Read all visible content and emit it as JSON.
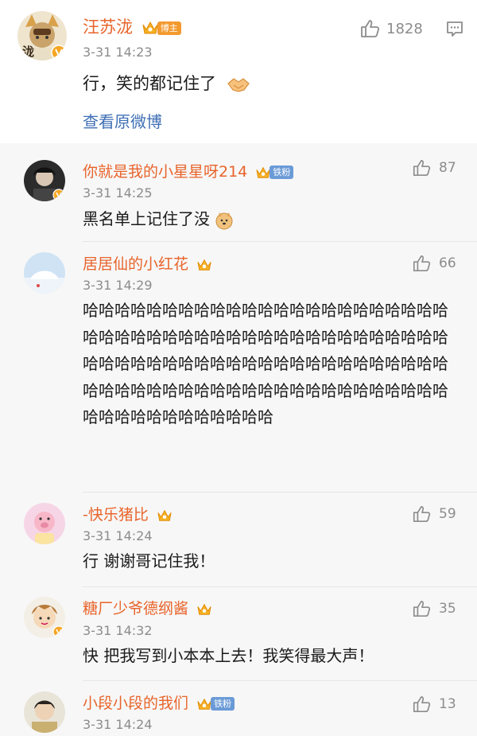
{
  "post": {
    "author": "汪苏泷",
    "badge": "博主",
    "time": "3-31 14:23",
    "text": "行，笑的都记住了",
    "view_original": "查看原微博",
    "likes": "1828",
    "avatar_char": "泷"
  },
  "comments": [
    {
      "name": "你就是我的小星星呀214",
      "badge": "铁粉",
      "time": "3-31 14:25",
      "text": "黑名单上记住了没",
      "likes": "87"
    },
    {
      "name": "居居仙的小红花",
      "time": "3-31 14:29",
      "text": "哈哈哈哈哈哈哈哈哈哈哈哈哈哈哈哈哈哈哈哈哈哈哈哈哈哈哈哈哈哈哈哈哈哈哈哈哈哈哈哈哈哈哈哈哈哈哈哈哈哈哈哈哈哈哈哈哈哈哈哈哈哈哈哈哈哈哈哈哈哈哈哈哈哈哈哈哈哈哈哈哈哈哈哈哈哈哈哈哈哈哈哈哈哈哈哈哈哈哈哈哈哈哈哈",
      "likes": "66"
    },
    {
      "name": "-快乐猪比",
      "time": "3-31 14:24",
      "text": "行 谢谢哥记住我！",
      "likes": "59"
    },
    {
      "name": "糖厂少爷德纲酱",
      "time": "3-31 14:32",
      "text": "快 把我写到小本本上去！我笑得最大声！",
      "likes": "35"
    },
    {
      "name": "小段小段的我们",
      "badge": "铁粉",
      "time": "3-31 14:24",
      "text": "",
      "likes": "13"
    }
  ],
  "colors": {
    "name": "#e8642b",
    "link": "#3f6fb5",
    "meta": "#8c8c8c",
    "comment_bg": "#f7f7f7"
  },
  "icons": [
    "thumbs-up-icon",
    "message-icon",
    "crown-icon",
    "verified-icon",
    "handshake-emoji",
    "doge-emoji"
  ]
}
